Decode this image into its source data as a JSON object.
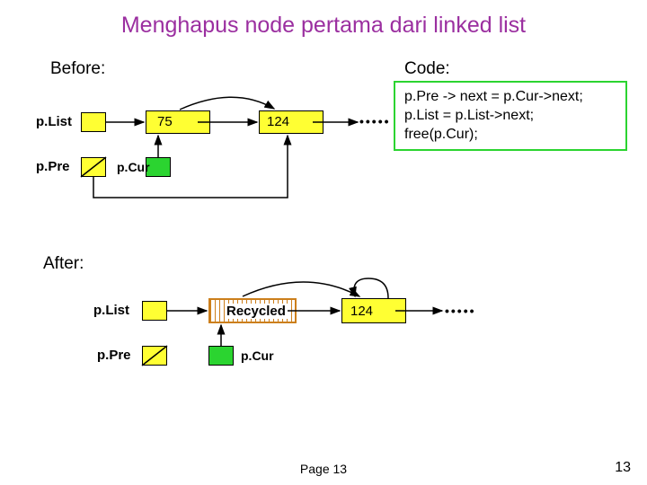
{
  "title": "Menghapus node pertama dari linked list",
  "labels": {
    "before": "Before:",
    "after": "After:",
    "code": "Code:",
    "pList": "p.List",
    "pPre": "p.Pre",
    "pCur": "p.Cur"
  },
  "nodes": {
    "n75": "75",
    "n124": "124",
    "recycled": "Recycled"
  },
  "code_lines": {
    "l1": "p.Pre -> next = p.Cur->next;",
    "l2": "p.List = p.List->next;",
    "l3": "free(p.Cur);"
  },
  "footer": {
    "page_center": "Page 13",
    "page_right": "13"
  }
}
